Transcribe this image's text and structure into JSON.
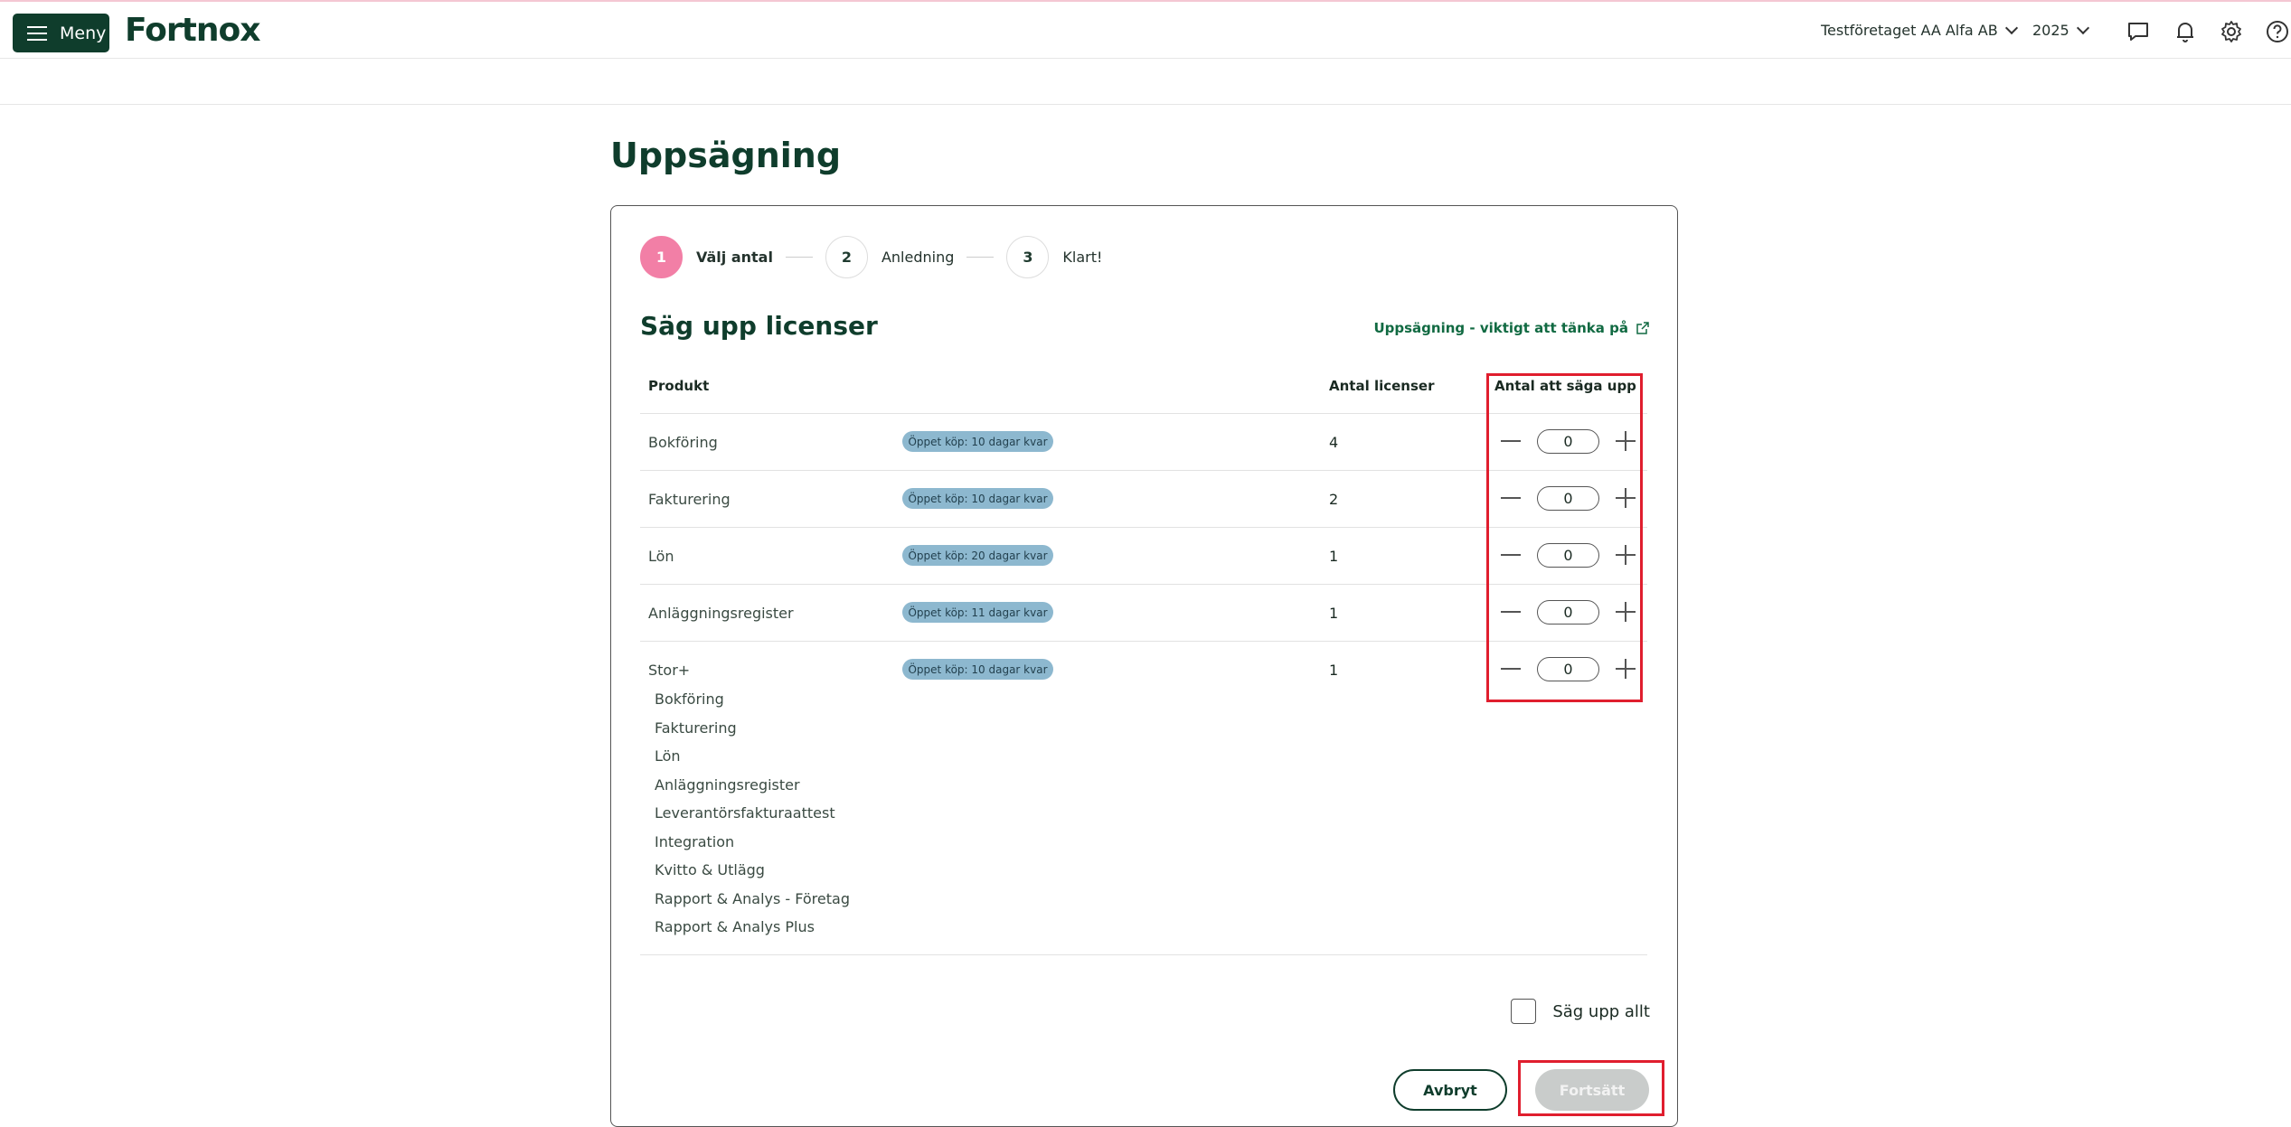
{
  "topbar": {
    "menu_label": "Meny",
    "logo": "Fortnox",
    "company": "Testföretaget AA Alfa AB",
    "year": "2025",
    "icons": [
      "chat-icon",
      "bell-icon",
      "gear-icon",
      "help-icon"
    ]
  },
  "page": {
    "title": "Uppsägning"
  },
  "stepper": [
    {
      "number": "1",
      "label": "Välj antal",
      "active": true
    },
    {
      "number": "2",
      "label": "Anledning",
      "active": false
    },
    {
      "number": "3",
      "label": "Klart!",
      "active": false
    }
  ],
  "section": {
    "title": "Säg upp licenser",
    "info_link": "Uppsägning - viktigt att tänka på"
  },
  "table": {
    "headers": {
      "product": "Produkt",
      "licenses": "Antal licenser",
      "to_cancel": "Antal att säga upp"
    },
    "rows": [
      {
        "product": "Bokföring",
        "badge": "Öppet köp: 10 dagar kvar",
        "licenses": "4",
        "to_cancel": "0"
      },
      {
        "product": "Fakturering",
        "badge": "Öppet köp: 10 dagar kvar",
        "licenses": "2",
        "to_cancel": "0"
      },
      {
        "product": "Lön",
        "badge": "Öppet köp: 20 dagar kvar",
        "licenses": "1",
        "to_cancel": "0"
      },
      {
        "product": "Anläggningsregister",
        "badge": "Öppet köp: 11 dagar kvar",
        "licenses": "1",
        "to_cancel": "0"
      },
      {
        "product": "Stor+",
        "badge": "Öppet köp: 10 dagar kvar",
        "licenses": "1",
        "to_cancel": "0"
      }
    ],
    "bundle_items": [
      "Bokföring",
      "Fakturering",
      "Lön",
      "Anläggningsregister",
      "Leverantörsfakturaattest",
      "Integration",
      "Kvitto & Utlägg",
      "Rapport & Analys - Företag",
      "Rapport & Analys Plus"
    ]
  },
  "footer": {
    "cancel_all_label": "Säg upp allt",
    "cancel_button": "Avbryt",
    "continue_button": "Fortsätt"
  },
  "colors": {
    "brand_dark_green": "#0f3d2c",
    "active_step_pink": "#f27fa6",
    "badge_blue": "#8db8cf",
    "highlight_red": "#e01e2e",
    "disabled_gray": "#c9cccb"
  }
}
